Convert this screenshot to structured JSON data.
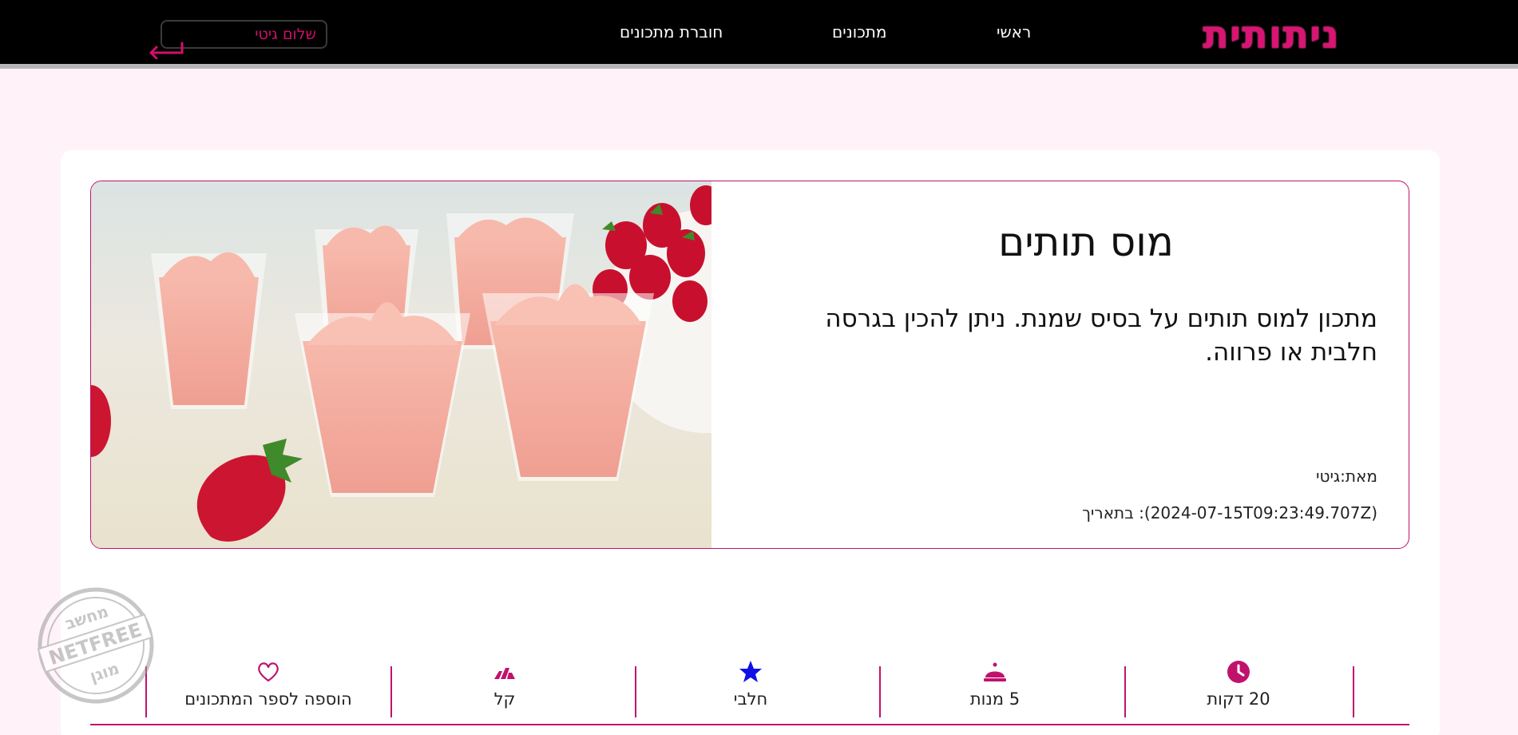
{
  "header": {
    "logo_text": "ניתותית",
    "nav": {
      "home": "ראשי",
      "recipes": "מתכונים",
      "recipe_book": "חוברת מתכונים"
    },
    "greeting": "שלום גיטי"
  },
  "recipe": {
    "title": "מוס תותים",
    "description": "מתכון למוס תותים על בסיס שמנת. ניתן להכין בגרסה חלבית או פרווה.",
    "author_line": "מאת:גיטי",
    "date_line": "בתאריך :(2024-07-15T09:23:49.707Z)"
  },
  "stats": [
    {
      "label": "20 דקות",
      "icon": "clock-icon"
    },
    {
      "label": "5 מנות",
      "icon": "serving-bell-icon"
    },
    {
      "label": "חלבי",
      "icon": "star-icon"
    },
    {
      "label": "קל",
      "icon": "difficulty-bars-icon"
    },
    {
      "label": "הוספה לספר המתכונים",
      "icon": "heart-icon"
    }
  ],
  "watermark": {
    "top": "מחשב",
    "middle": "NETFREE",
    "bottom": "מוגן"
  },
  "colors": {
    "accent": "#c0126d",
    "logo": "#d91473",
    "page_bg": "#fff3f9",
    "header_bg": "#000000",
    "star": "#1010e6"
  }
}
